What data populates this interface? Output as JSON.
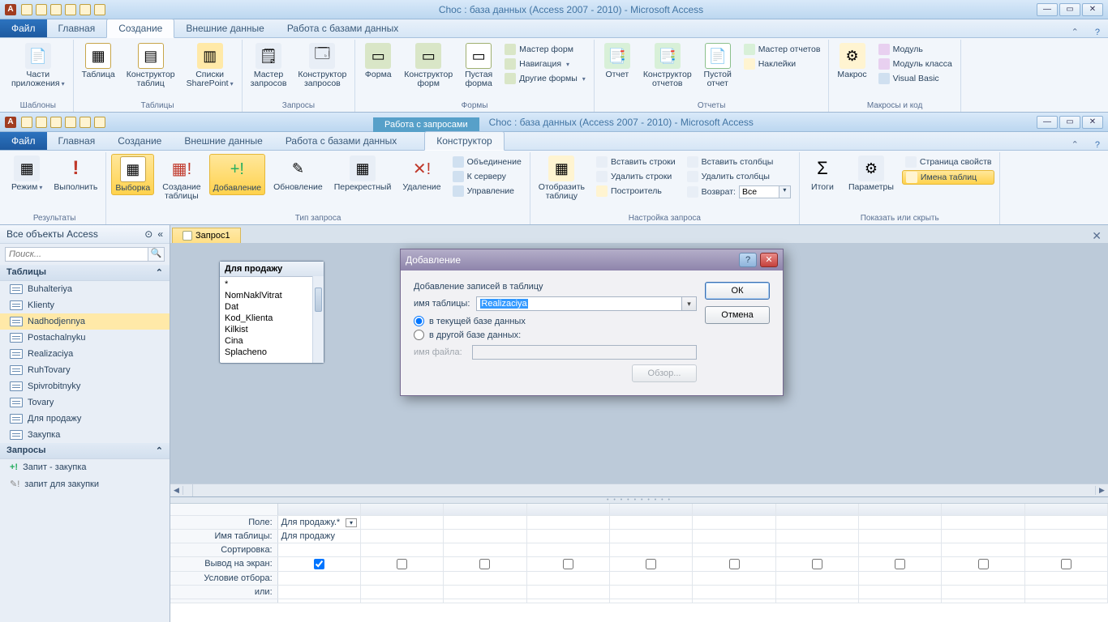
{
  "top_window": {
    "title": "Choc : база данных (Access 2007 - 2010)  -  Microsoft Access",
    "file_btn": "Файл",
    "tabs": {
      "home": "Главная",
      "create": "Создание",
      "external": "Внешние данные",
      "dbwork": "Работа с базами данных"
    },
    "ribbon": {
      "templates": {
        "app_parts": "Части\nприложения",
        "group": "Шаблоны"
      },
      "tables": {
        "table": "Таблица",
        "designer": "Конструктор\nтаблиц",
        "sharepoint": "Списки\nSharePoint",
        "group": "Таблицы"
      },
      "queries": {
        "wizard": "Мастер\nзапросов",
        "designer": "Конструктор\nзапросов",
        "group": "Запросы"
      },
      "forms": {
        "form": "Форма",
        "designer": "Конструктор\nформ",
        "blank": "Пустая\nформа",
        "wizard": "Мастер форм",
        "nav": "Навигация",
        "other": "Другие формы",
        "group": "Формы"
      },
      "reports": {
        "report": "Отчет",
        "designer": "Конструктор\nотчетов",
        "blank": "Пустой\nотчет",
        "wizard": "Мастер отчетов",
        "labels": "Наклейки",
        "group": "Отчеты"
      },
      "macros": {
        "macro": "Макрос",
        "module": "Модуль",
        "class_module": "Модуль класса",
        "vb": "Visual Basic",
        "group": "Макросы и код"
      }
    }
  },
  "second_window": {
    "title": "Choc : база данных (Access 2007 - 2010)  -  Microsoft Access",
    "file_btn": "Файл",
    "tabs": {
      "home": "Главная",
      "create": "Создание",
      "external": "Внешние данные",
      "dbwork": "Работа с базами данных",
      "ctx_group": "Работа с запросами",
      "ctx_tab": "Конструктор"
    },
    "ribbon": {
      "results": {
        "view": "Режим",
        "run": "Выполнить",
        "group": "Результаты"
      },
      "querytype": {
        "select": "Выборка",
        "maketable": "Создание\nтаблицы",
        "append": "Добавление",
        "update": "Обновление",
        "crosstab": "Перекрестный",
        "delete": "Удаление",
        "union": "Объединение",
        "passthrough": "К серверу",
        "datadef": "Управление",
        "group": "Тип запроса"
      },
      "querysetup": {
        "showtable": "Отобразить\nтаблицу",
        "insert_rows": "Вставить строки",
        "delete_rows": "Удалить строки",
        "builder": "Построитель",
        "insert_cols": "Вставить столбцы",
        "delete_cols": "Удалить столбцы",
        "return_label": "Возврат:",
        "return_value": "Все",
        "group": "Настройка запроса"
      },
      "showhide": {
        "totals": "Итоги",
        "params": "Параметры",
        "propsheet": "Страница свойств",
        "tablenames": "Имена таблиц",
        "group": "Показать или скрыть"
      }
    }
  },
  "sidebar": {
    "title": "Все объекты Access",
    "search_placeholder": "Поиск...",
    "tables_header": "Таблицы",
    "tables": [
      "Buhalteriya",
      "Klienty",
      "Nadhodjennya",
      "Postachalnyku",
      "Realizaciya",
      "RuhTovary",
      "Spivrobitnyky",
      "Tovary",
      "Для продажу",
      "Закупка"
    ],
    "tables_selected": "Nadhodjennya",
    "queries_header": "Запросы",
    "queries": [
      "Запит - закупка",
      "запит для закупки"
    ]
  },
  "doc": {
    "tab": "Запрос1",
    "tablebox": {
      "title": "Для продажу",
      "fields": [
        "*",
        "NomNaklVitrat",
        "Dat",
        "Kod_Klienta",
        "Kilkist",
        "Cina",
        "Splacheno"
      ]
    },
    "grid": {
      "labels": {
        "field": "Поле:",
        "table": "Имя таблицы:",
        "sort": "Сортировка:",
        "show": "Вывод на экран:",
        "criteria": "Условие отбора:",
        "or": "или:"
      },
      "field_value": "Для продажу.*",
      "table_value": "Для продажу"
    }
  },
  "dialog": {
    "title": "Добавление",
    "legend": "Добавление записей в таблицу",
    "table_label": "имя таблицы:",
    "table_value": "Realizaciya",
    "radio_current": "в текущей базе данных",
    "radio_other": "в другой базе данных:",
    "file_label": "имя файла:",
    "browse": "Обзор...",
    "ok": "ОК",
    "cancel": "Отмена"
  }
}
